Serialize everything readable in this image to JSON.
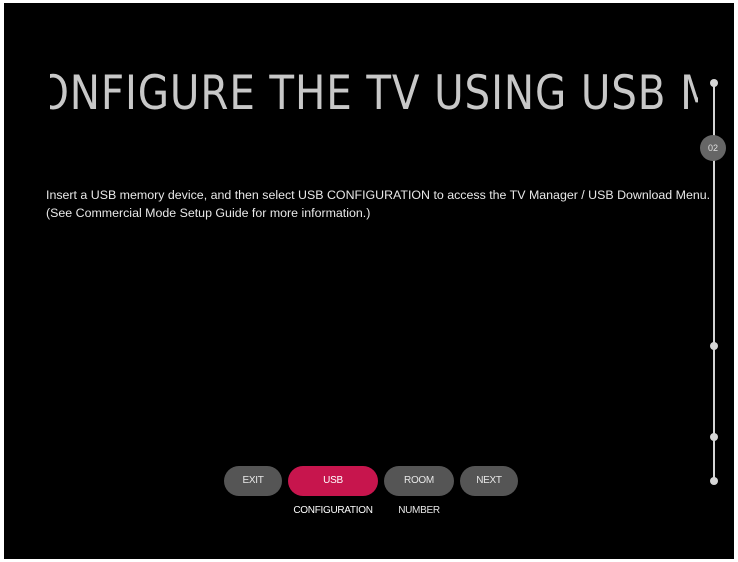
{
  "page": {
    "title": "CONFIGURE THE TV USING USB MEMORY DEVICE",
    "description": [
      "Insert a USB memory device, and then select USB CONFIGURATION to access the TV Manager / USB Download Menu.",
      "(See Commercial Mode Setup Guide for more information.)"
    ]
  },
  "progress": {
    "current_step": "02"
  },
  "buttons": {
    "exit": "EXIT",
    "usb_configuration": "USB CONFIGURATION",
    "room_number": "ROOM NUMBER",
    "next": "NEXT"
  },
  "colors": {
    "background": "#000000",
    "accent": "#c7154d",
    "button": "#555555"
  }
}
